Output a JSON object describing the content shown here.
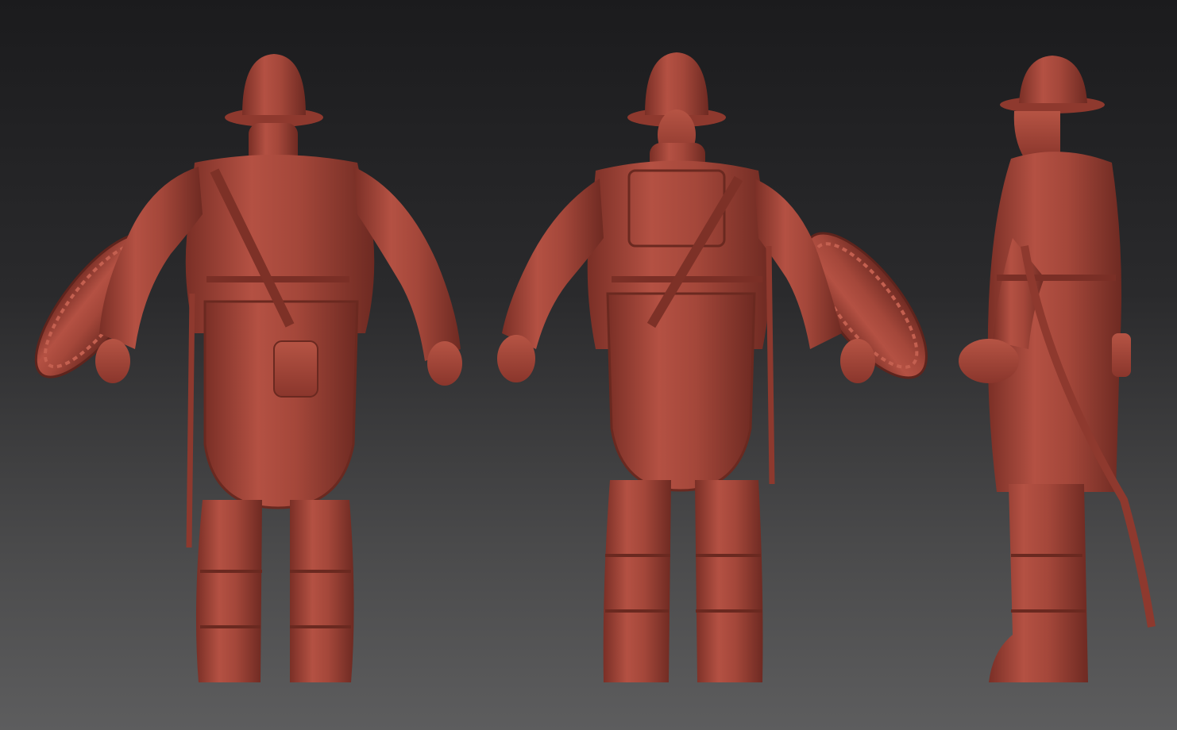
{
  "scene": {
    "subject": "sculpted-model-turnaround",
    "views": [
      {
        "id": "back",
        "icon": "soldier-back-view-icon"
      },
      {
        "id": "front",
        "icon": "soldier-front-view-icon"
      },
      {
        "id": "side",
        "icon": "soldier-side-view-icon"
      }
    ],
    "colors": {
      "material": "#a4473a",
      "material_light": "#c05a48",
      "material_dark": "#6e2a22",
      "background_top": "#1b1b1d",
      "background_bottom": "#5d5d5e"
    }
  }
}
